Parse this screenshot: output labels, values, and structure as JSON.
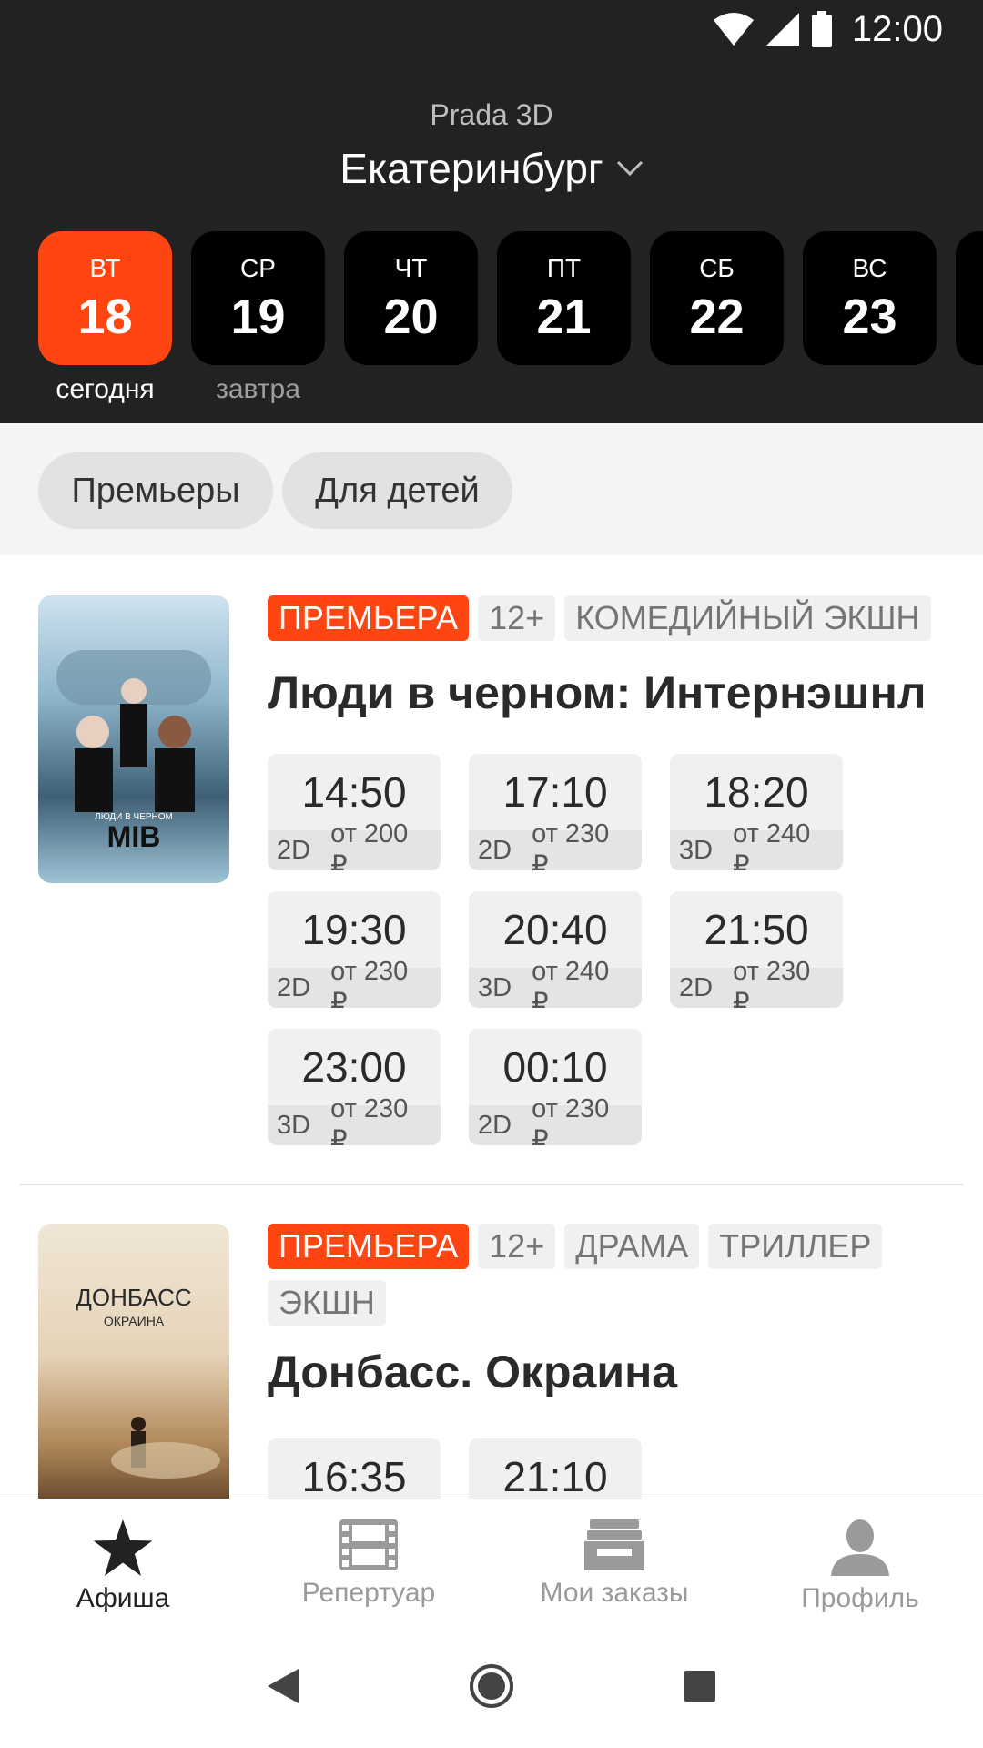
{
  "status": {
    "time": "12:00"
  },
  "header": {
    "cinema": "Prada 3D",
    "city": "Екатеринбург"
  },
  "dates": [
    {
      "dow": "ВТ",
      "num": "18",
      "sub": "сегодня",
      "active": true
    },
    {
      "dow": "СР",
      "num": "19",
      "sub": "завтра"
    },
    {
      "dow": "ЧТ",
      "num": "20",
      "sub": ""
    },
    {
      "dow": "ПТ",
      "num": "21",
      "sub": ""
    },
    {
      "dow": "СБ",
      "num": "22",
      "sub": ""
    },
    {
      "dow": "ВС",
      "num": "23",
      "sub": ""
    }
  ],
  "filters": [
    "Премьеры",
    "Для детей"
  ],
  "movies": [
    {
      "title": "Люди в черном: Интернэшнл",
      "tags": [
        "ПРЕМЬЕРА",
        "12+",
        "КОМЕДИЙНЫЙ ЭКШН"
      ],
      "poster_text": "MIB",
      "poster_sub": "ЛЮДИ В ЧЕРНОМ",
      "sessions": [
        {
          "time": "14:50",
          "format": "2D",
          "price": "от 200 ₽"
        },
        {
          "time": "17:10",
          "format": "2D",
          "price": "от 230 ₽"
        },
        {
          "time": "18:20",
          "format": "3D",
          "price": "от 240 ₽"
        },
        {
          "time": "19:30",
          "format": "2D",
          "price": "от 230 ₽"
        },
        {
          "time": "20:40",
          "format": "3D",
          "price": "от 240 ₽"
        },
        {
          "time": "21:50",
          "format": "2D",
          "price": "от 230 ₽"
        },
        {
          "time": "23:00",
          "format": "3D",
          "price": "от 230 ₽"
        },
        {
          "time": "00:10",
          "format": "2D",
          "price": "от 230 ₽"
        }
      ]
    },
    {
      "title": "Донбасс. Окраина",
      "tags": [
        "ПРЕМЬЕРА",
        "12+",
        "ДРАМА",
        "ТРИЛЛЕР",
        "ЭКШН"
      ],
      "poster_text": "ДОНБАСС",
      "poster_sub": "ОКРАИНА",
      "sessions": [
        {
          "time": "16:35"
        },
        {
          "time": "21:10"
        }
      ]
    }
  ],
  "nav": [
    "Афиша",
    "Репертуар",
    "Мои заказы",
    "Профиль"
  ],
  "colors": {
    "accent": "#ff4612",
    "header_bg": "#222222"
  }
}
